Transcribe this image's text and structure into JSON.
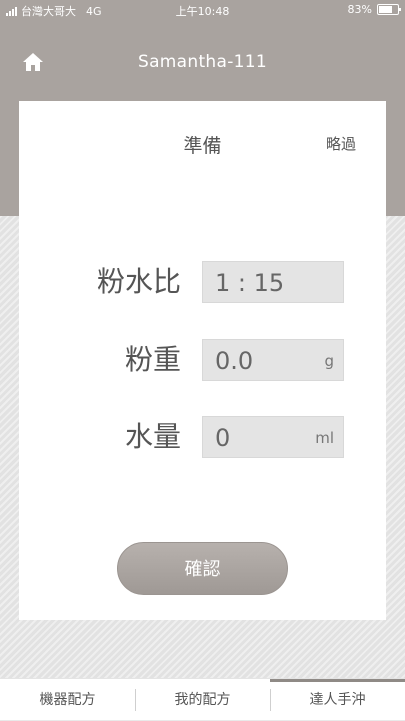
{
  "status_bar": {
    "carrier": "台灣大哥大",
    "network": "4G",
    "time": "上午10:48",
    "battery": "83%",
    "battery_level": 0.83
  },
  "header": {
    "title": "Samantha-111",
    "home_icon": "home-icon"
  },
  "card": {
    "title": "準備",
    "skip_label": "略過",
    "rows": [
      {
        "label": "粉水比",
        "value": "1 : 15",
        "unit": ""
      },
      {
        "label": "粉重",
        "value": "0.0",
        "unit": "g"
      },
      {
        "label": "水量",
        "value": "0",
        "unit": "ml"
      }
    ],
    "confirm_label": "確認"
  },
  "tabs": [
    {
      "label": "機器配方"
    },
    {
      "label": "我的配方"
    },
    {
      "label": "達人手沖"
    }
  ],
  "active_tab": 2,
  "colors": {
    "header_bg": "#a9a39f",
    "button_bg": "#a9a39f",
    "card_bg": "#ffffff"
  }
}
